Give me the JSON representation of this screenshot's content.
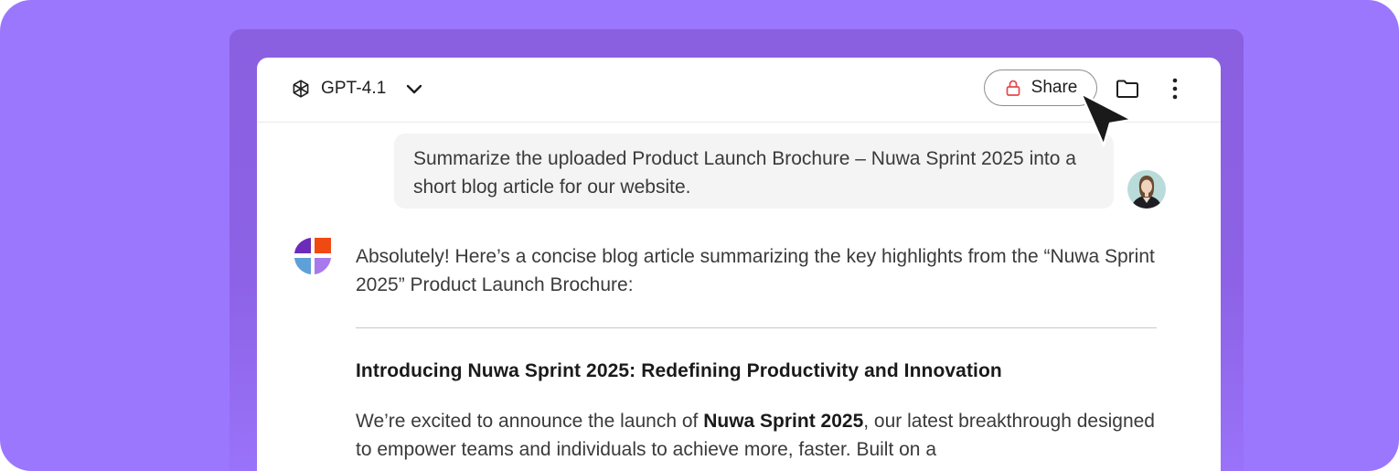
{
  "topbar": {
    "model_name": "GPT-4.1",
    "share_label": "Share"
  },
  "icons": {
    "model": "openai-logo-icon",
    "model_dropdown": "chevron-down-icon",
    "share": "lock-icon",
    "folder": "folder-icon",
    "more": "more-vertical-icon",
    "assistant": "brand-logo-icon",
    "cursor": "mouse-pointer-icon"
  },
  "conversation": {
    "user_message": "Summarize the uploaded Product Launch Brochure – Nuwa Sprint 2025 into a short blog article for our website.",
    "assistant_intro": "Absolutely! Here’s a concise blog article summarizing the key highlights from the “Nuwa Sprint 2025” Product Launch Brochure:",
    "article_title": "Introducing Nuwa Sprint 2025: Redefining Productivity and Innovation",
    "article_body_before": "We’re excited to announce the launch of ",
    "article_body_bold": "Nuwa Sprint 2025",
    "article_body_after": ", our latest breakthrough designed to empower teams and individuals to achieve more, faster. Built on a"
  },
  "colors": {
    "background": "#9b77fe",
    "back_panel": "#8b60e3",
    "lock_red": "#e5484d",
    "logo_purple_dark": "#6c2bb8",
    "logo_orange": "#f04a12",
    "logo_blue": "#5ea0d8",
    "logo_purple_light": "#a779ec"
  }
}
